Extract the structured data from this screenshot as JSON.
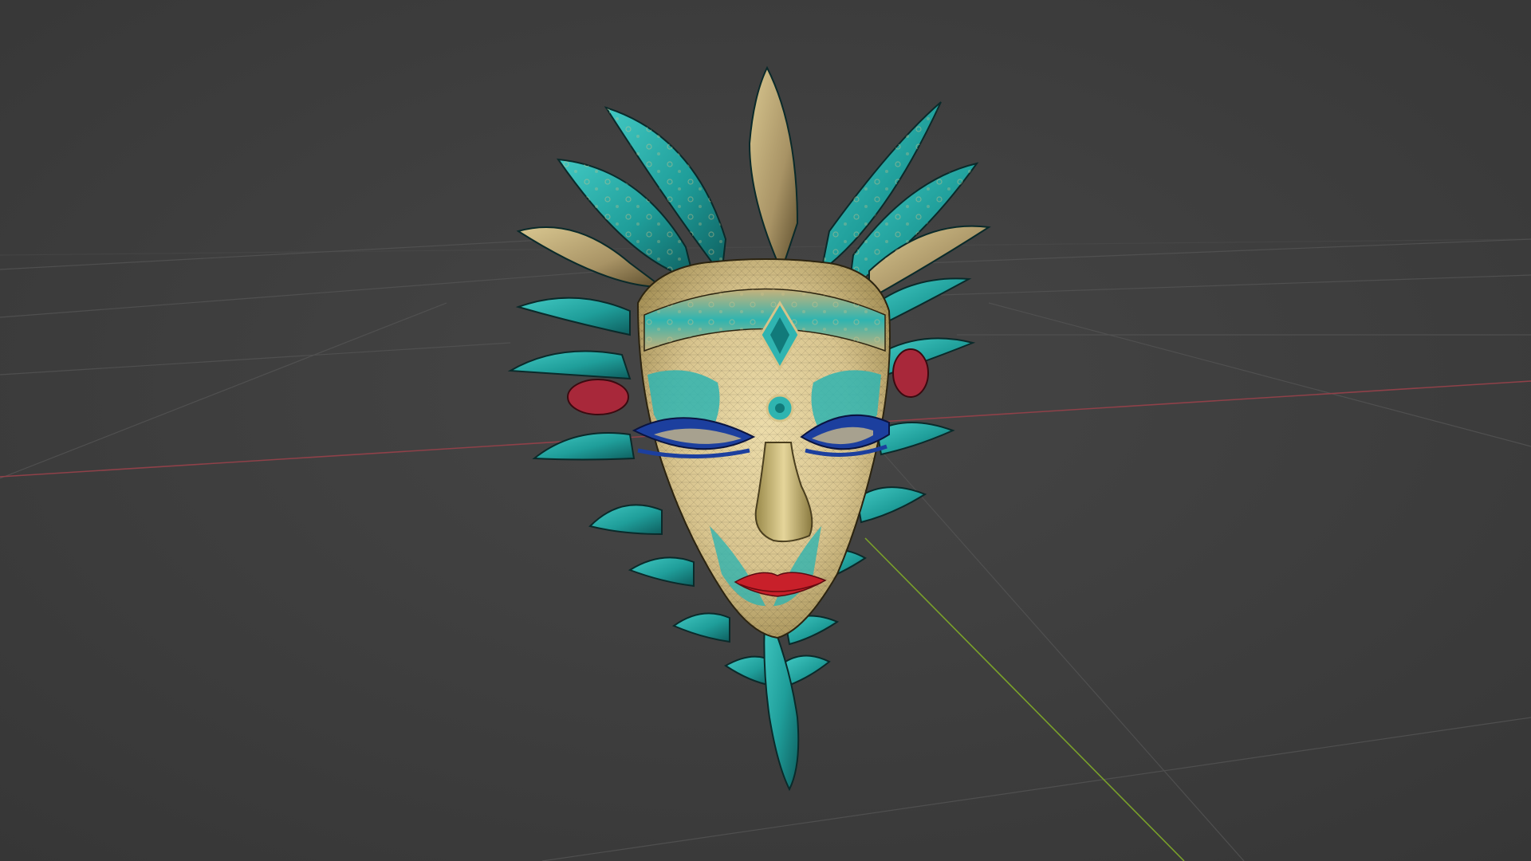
{
  "viewport": {
    "background_color": "#3d3d3d",
    "grid_color": "#505050",
    "x_axis_color": "#9a4a52",
    "y_axis_color": "#6f9a2a"
  },
  "model": {
    "subject": "masquerade-mask",
    "palette": {
      "turquoise": "#2fb4b0",
      "turquoise_dark": "#117a7a",
      "gold": "#c9b27a",
      "cream": "#e6d7a8",
      "lips_red": "#c8202a",
      "eye_blue": "#1c3f9e",
      "ornament_red": "#a8283a"
    }
  }
}
